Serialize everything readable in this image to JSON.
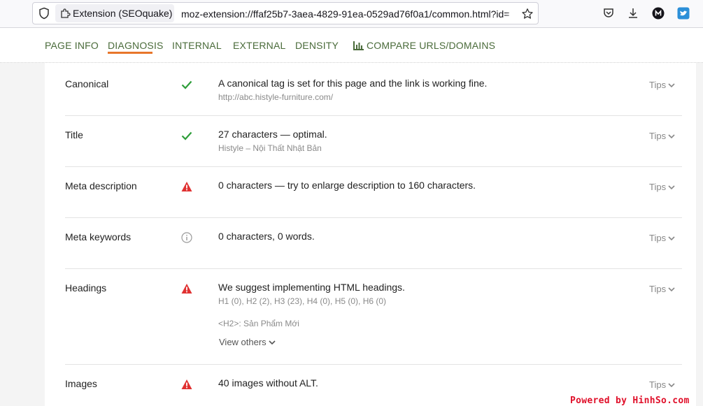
{
  "browser": {
    "extension_label": "Extension (SEOquake)",
    "url": "moz-extension://ffaf25b7-3aea-4829-91ea-0529ad76f0a1/common.html?id="
  },
  "tabs": [
    {
      "label": "PAGE INFO"
    },
    {
      "label": "DIAGNOSIS"
    },
    {
      "label": "INTERNAL"
    },
    {
      "label": "EXTERNAL"
    },
    {
      "label": "DENSITY"
    },
    {
      "label": "COMPARE URLS/DOMAINS"
    }
  ],
  "active_tab": "DIAGNOSIS",
  "tips_label": "Tips",
  "rows": [
    {
      "label": "Canonical",
      "status": "ok",
      "message": "A canonical tag is set for this page and the link is working fine.",
      "detail": "http://abc.histyle-furniture.com/"
    },
    {
      "label": "Title",
      "status": "ok",
      "message": "27 characters — optimal.",
      "detail": "Histyle – Nội Thất Nhật Bản"
    },
    {
      "label": "Meta description",
      "status": "warning",
      "message": "0 characters — try to enlarge description to 160 characters."
    },
    {
      "label": "Meta keywords",
      "status": "info",
      "message": "0 characters, 0 words."
    },
    {
      "label": "Headings",
      "status": "warning",
      "message": "We suggest implementing HTML headings.",
      "detail": "H1 (0), H2 (2), H3 (23), H4 (0), H5 (0), H6 (0)",
      "detail2": "<H2>: Sản Phẩm Mới",
      "view_others": "View others"
    },
    {
      "label": "Images",
      "status": "warning",
      "message": "40 images without ALT."
    }
  ],
  "colors": {
    "ok": "#2e9e3a",
    "warning": "#e03131",
    "info": "#9a9a9a",
    "tab_text": "#4a6b3a",
    "tab_active_underline": "#e8762b"
  },
  "watermark": "Powered by HinhSo.com"
}
